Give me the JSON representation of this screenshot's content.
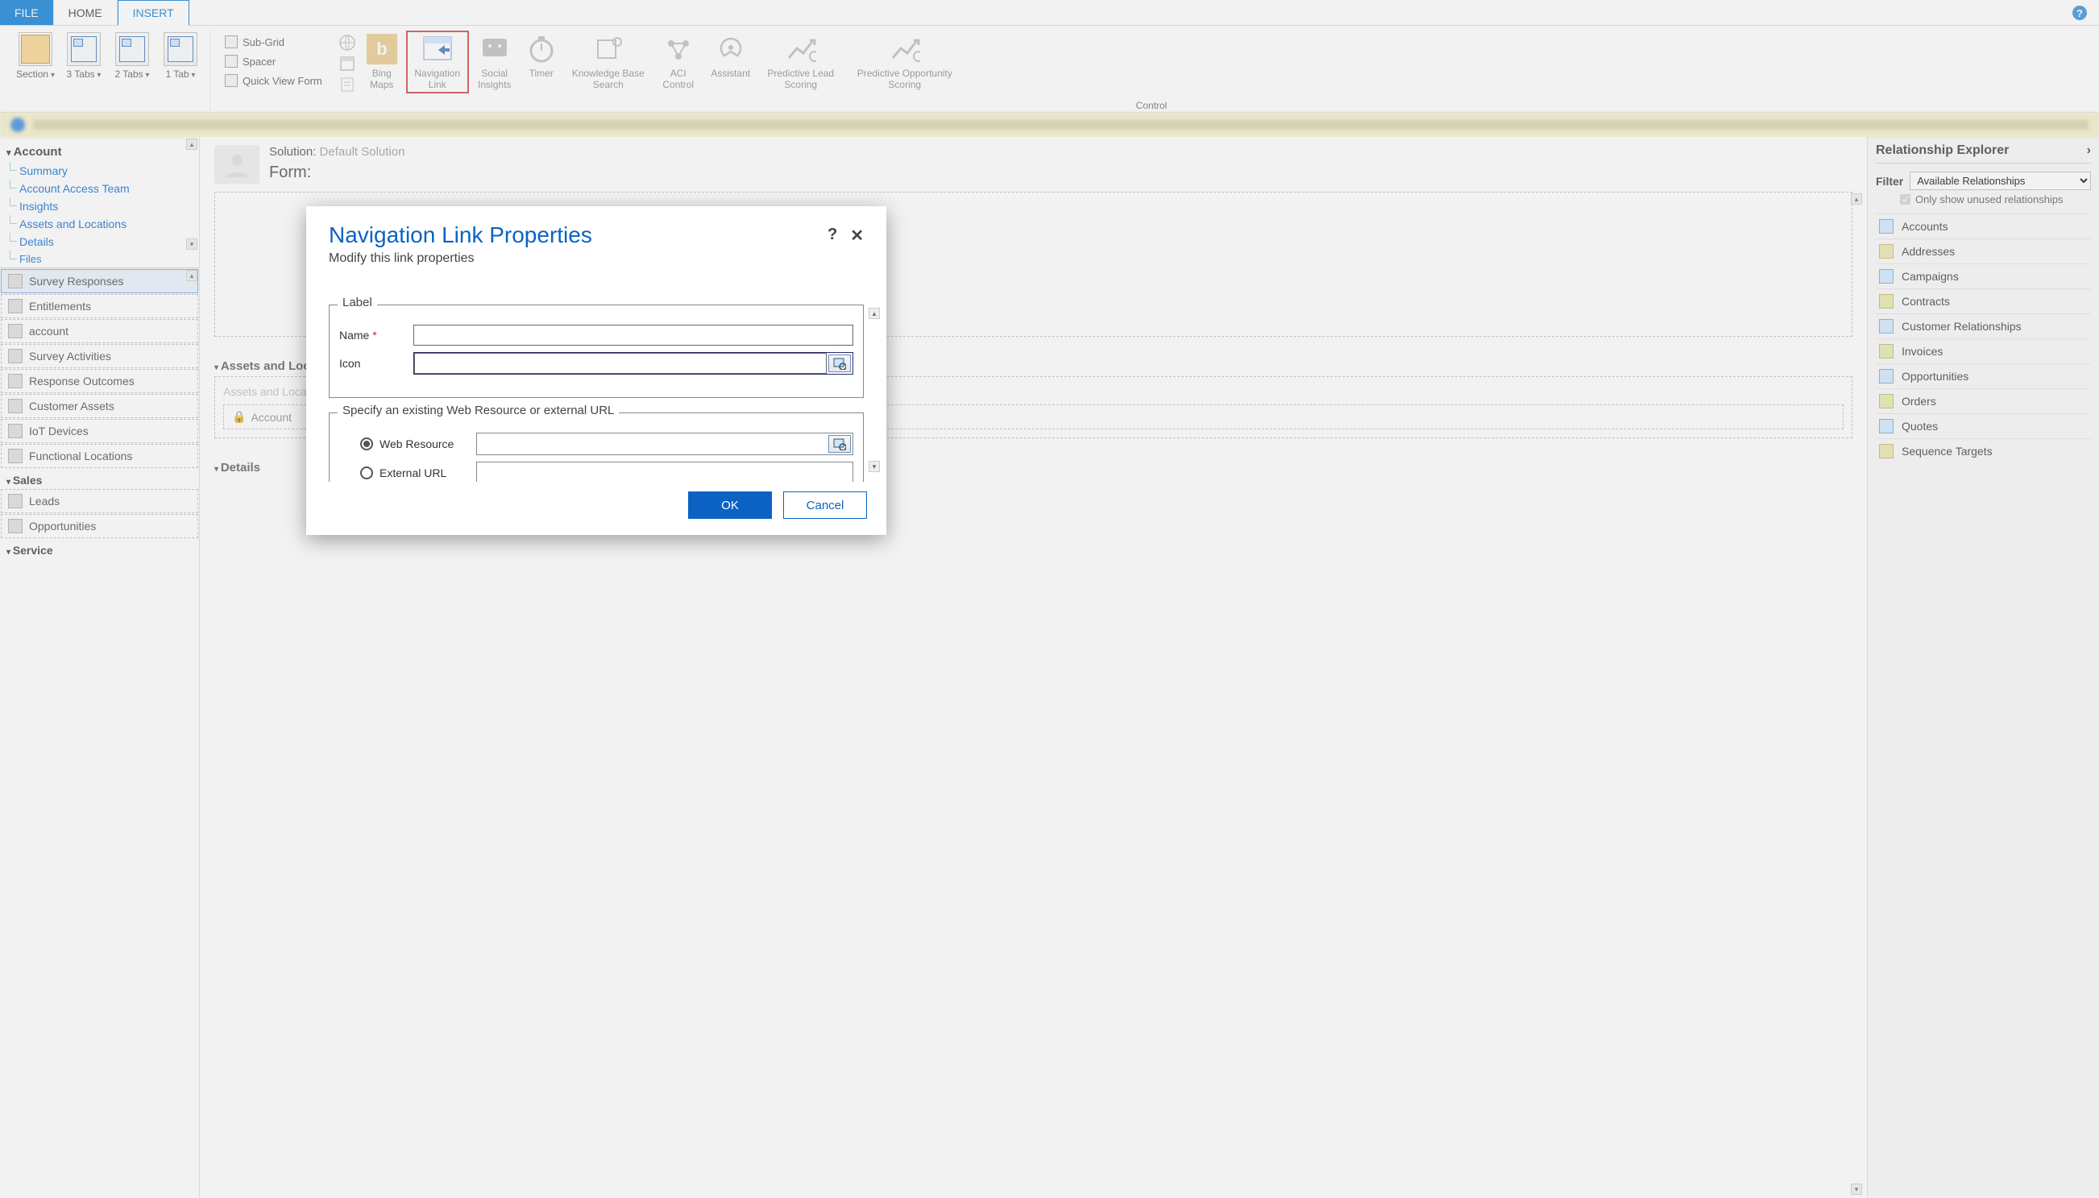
{
  "tabs": {
    "file": "FILE",
    "home": "HOME",
    "insert": "INSERT"
  },
  "ribbon": {
    "section": "Section",
    "tabs3": "3 Tabs",
    "tabs2": "2 Tabs",
    "tabs1": "1 Tab",
    "subgrid": "Sub-Grid",
    "spacer": "Spacer",
    "quickview": "Quick View Form",
    "bing": "Bing Maps",
    "navlink": "Navigation Link",
    "social": "Social Insights",
    "timer": "Timer",
    "kbsearch": "Knowledge Base Search",
    "aci": "ACI Control",
    "assistant": "Assistant",
    "pls": "Predictive Lead Scoring",
    "pos": "Predictive Opportunity Scoring",
    "group_label": "Control"
  },
  "tree": {
    "root": "Account",
    "items": [
      "Summary",
      "Account Access Team",
      "Insights",
      "Assets and Locations",
      "Details",
      "Files"
    ]
  },
  "nav": {
    "selected": "Survey Responses",
    "items": [
      "Entitlements",
      "account",
      "Survey Activities",
      "Response Outcomes",
      "Customer Assets",
      "IoT Devices",
      "Functional Locations"
    ],
    "groups": {
      "sales": "Sales",
      "sales_items": [
        "Leads",
        "Opportunities"
      ],
      "service": "Service"
    }
  },
  "form": {
    "solution_prefix": "Solution:",
    "form_prefix": "Form:",
    "section_assets": "Assets and Locations",
    "sub_assets": "Assets and Locations",
    "field_account": "Account",
    "section_details": "Details"
  },
  "right": {
    "title": "Relationship Explorer",
    "filter_label": "Filter",
    "filter_value": "Available Relationships",
    "chk": "Only show unused relationships",
    "items": [
      "Accounts",
      "Addresses",
      "Campaigns",
      "Contracts",
      "Customer Relationships",
      "Invoices",
      "Opportunities",
      "Orders",
      "Quotes",
      "Sequence Targets"
    ]
  },
  "modal": {
    "title": "Navigation Link Properties",
    "subtitle": "Modify this link properties",
    "legend_label": "Label",
    "name": "Name",
    "icon": "Icon",
    "legend_target": "Specify an existing Web Resource or external URL",
    "opt_web": "Web Resource",
    "opt_ext": "External URL",
    "ok": "OK",
    "cancel": "Cancel"
  }
}
